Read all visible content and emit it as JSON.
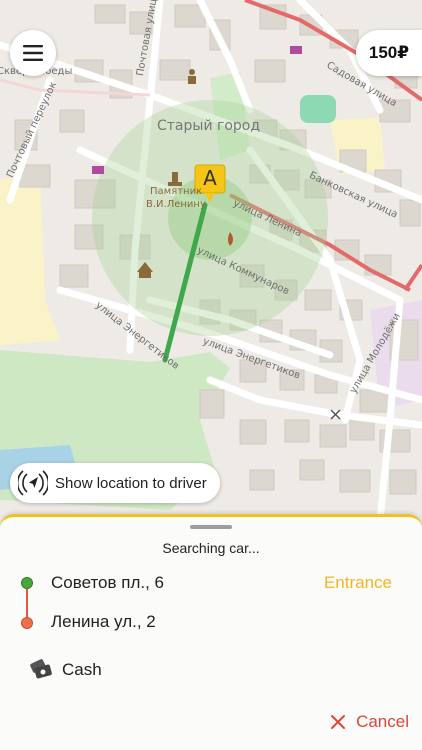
{
  "map": {
    "district_label": "Старый город",
    "monument_label_line1": "Памятник",
    "monument_label_line2": "В.И.Ленину",
    "street_labels": [
      "Почтовая улица",
      "Банковская улица",
      "улица Ленина",
      "улица Коммунаров",
      "улица Энергетиков",
      "улица Энергетиков",
      "улица Молодёжи",
      "Почтовый переулок",
      "Садовая улица",
      "Сквер Победы"
    ],
    "pickup_marker_letter": "A",
    "accent_color": "#f5c518",
    "route_color": "#3ea84b"
  },
  "top_bar": {
    "menu_icon": "hamburger-menu-icon",
    "price": "150₽"
  },
  "show_location_button": {
    "label": "Show location to driver",
    "icon": "location-broadcast-icon"
  },
  "sheet": {
    "status": "Searching car...",
    "pickup": "Советов пл., 6",
    "dropoff": "Ленина ул., 2",
    "entrance_label": "Entrance",
    "payment_label": "Cash",
    "payment_icon": "cash-icon",
    "cancel_label": "Cancel",
    "cancel_icon": "close-icon",
    "colors": {
      "accent": "#f1c21c",
      "cancel": "#e0443a",
      "pickup_dot": "#48a63d",
      "dropoff_dot": "#f0704d"
    }
  }
}
